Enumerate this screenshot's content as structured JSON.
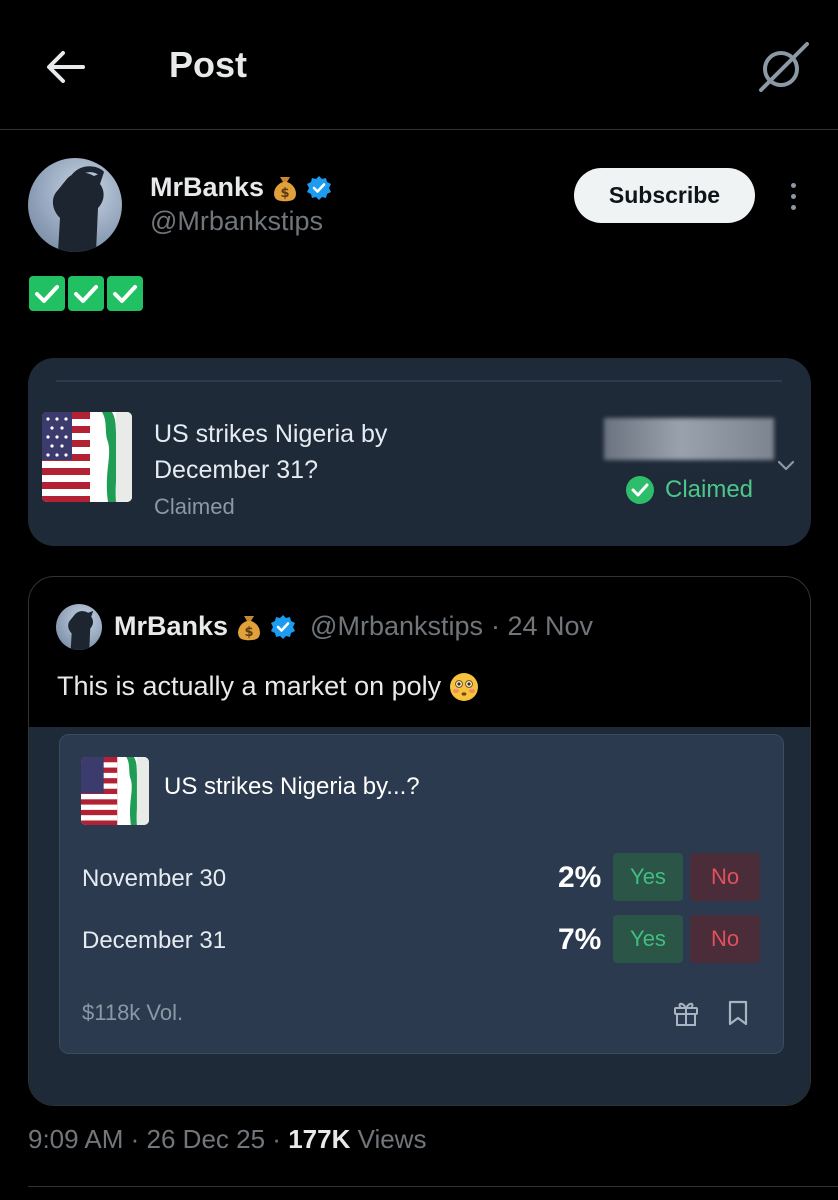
{
  "header": {
    "title": "Post",
    "back_icon": "arrow-left-icon",
    "grok_icon": "grok-icon"
  },
  "post": {
    "author_name": "MrBanks",
    "author_emoji": "money-bag-icon",
    "verified_icon": "verified-badge-icon",
    "author_handle": "@Mrbankstips",
    "subscribe_label": "Subscribe",
    "checks_count": 3,
    "claim_card": {
      "title": "US strikes Nigeria by December 31?",
      "status": "Claimed",
      "badge_label": "Claimed"
    },
    "quoted": {
      "author_name": "MrBanks",
      "author_handle": "@Mrbankstips",
      "date": "· 24 Nov",
      "text": "This is actually a market on poly",
      "emoji": "flushed-face-icon",
      "market": {
        "title": "US strikes Nigeria by...?",
        "rows": [
          {
            "label": "November 30",
            "pct": "2%",
            "yes": "Yes",
            "no": "No"
          },
          {
            "label": "December 31",
            "pct": "7%",
            "yes": "Yes",
            "no": "No"
          }
        ],
        "volume": "$118k Vol."
      }
    },
    "meta": {
      "time": "9:09 AM",
      "date": "26 Dec 25",
      "views_count": "177K",
      "views_label": "Views"
    }
  },
  "colors": {
    "background": "#000000",
    "card": "#1e2a38",
    "market": "#2b3a4e",
    "accent_blue": "#1d9bf0",
    "claimed_green": "#4cc78a",
    "yes_green": "#3fbf7f",
    "no_red": "#e0515b"
  }
}
